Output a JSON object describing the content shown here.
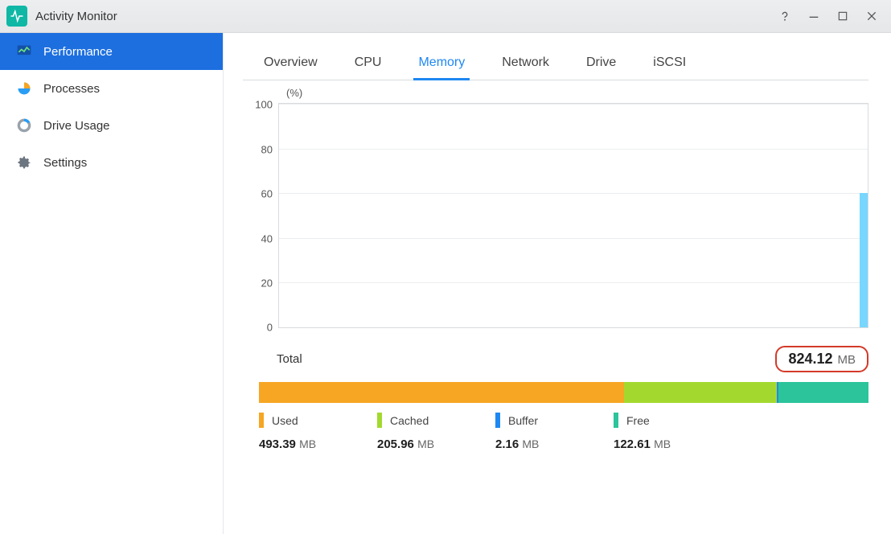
{
  "title": "Activity Monitor",
  "sidebar": {
    "items": [
      {
        "label": "Performance"
      },
      {
        "label": "Processes"
      },
      {
        "label": "Drive Usage"
      },
      {
        "label": "Settings"
      }
    ]
  },
  "tabs": [
    {
      "label": "Overview"
    },
    {
      "label": "CPU"
    },
    {
      "label": "Memory",
      "active": true
    },
    {
      "label": "Network"
    },
    {
      "label": "Drive"
    },
    {
      "label": "iSCSI"
    }
  ],
  "chart_data": {
    "type": "line",
    "title": "",
    "xlabel": "",
    "ylabel": "(%)",
    "ylim": [
      0,
      100
    ],
    "y_ticks": [
      0,
      20,
      40,
      60,
      80,
      100
    ],
    "categories": [],
    "values": [
      60
    ],
    "comment": "Time-series memory utilization; only the most recent sample (~60%) is visible at the right edge."
  },
  "total": {
    "label": "Total",
    "value": "824.12",
    "unit": "MB"
  },
  "breakdown": [
    {
      "name": "Used",
      "value": "493.39",
      "unit": "MB",
      "color": "#f6a623",
      "fraction": 0.599
    },
    {
      "name": "Cached",
      "value": "205.96",
      "unit": "MB",
      "color": "#a3d92e",
      "fraction": 0.25
    },
    {
      "name": "Buffer",
      "value": "2.16",
      "unit": "MB",
      "color": "#1e88f2",
      "fraction": 0.003
    },
    {
      "name": "Free",
      "value": "122.61",
      "unit": "MB",
      "color": "#2bc49b",
      "fraction": 0.148
    }
  ]
}
